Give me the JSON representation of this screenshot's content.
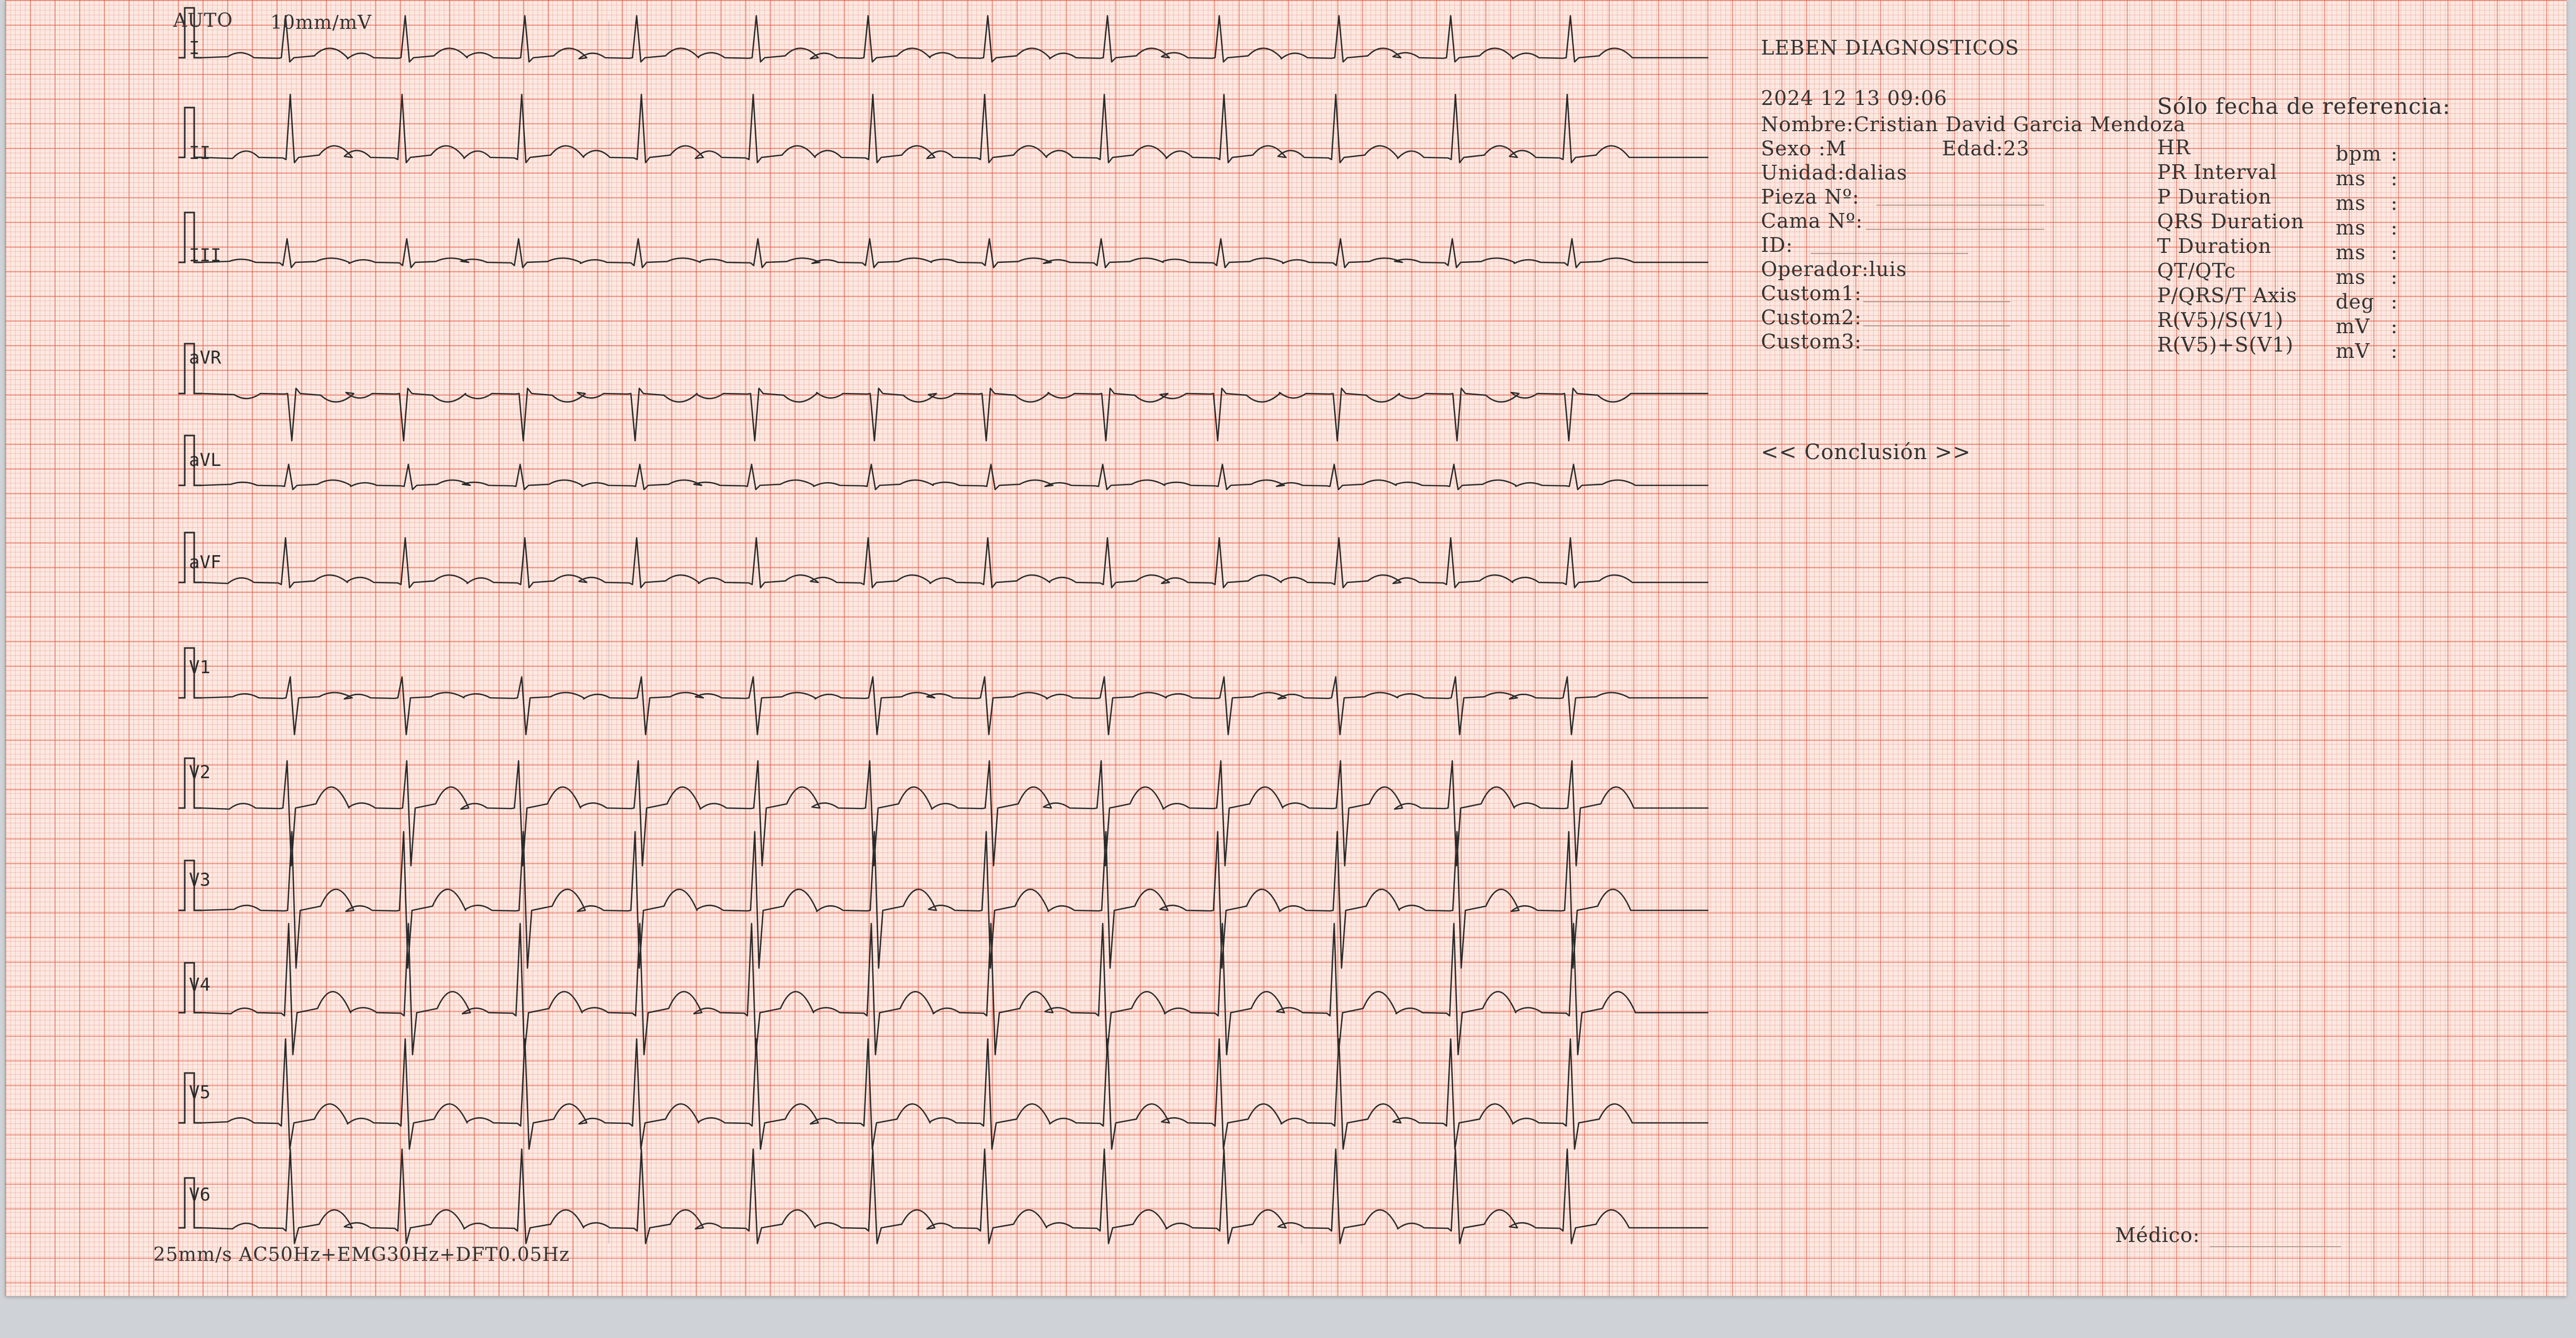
{
  "header": {
    "mode": "AUTO",
    "gain": "10mm/mV",
    "footer_settings": "25mm/s   AC50Hz+EMG30Hz+DFT0.05Hz"
  },
  "clinic": "LEBEN DIAGNOSTICOS",
  "patient": {
    "datetime": "2024 12 13 09:06",
    "name": "Nombre:Cristian David Garcia Mendoza",
    "sex": "Sexo  :M",
    "age": "Edad:23",
    "unit": "Unidad:dalias",
    "piece": "Pieza Nº:",
    "bed": "Cama Nº:",
    "id": "ID:",
    "operator": "Operador:luis",
    "custom1": "Custom1:",
    "custom2": "Custom2:",
    "custom3": "Custom3:"
  },
  "measurements": {
    "reference_note": "Sólo fecha de referencia:",
    "rows": [
      {
        "label": "HR",
        "unit": "bpm",
        "value": ":"
      },
      {
        "label": "PR Interval",
        "unit": "ms",
        "value": ":"
      },
      {
        "label": "P Duration",
        "unit": "ms",
        "value": ":"
      },
      {
        "label": "QRS Duration",
        "unit": "ms",
        "value": ":"
      },
      {
        "label": "T Duration",
        "unit": "ms",
        "value": ":"
      },
      {
        "label": "QT/QTc",
        "unit": "ms",
        "value": ":"
      },
      {
        "label": "P/QRS/T Axis",
        "unit": "deg",
        "value": ":"
      },
      {
        "label": "R(V5)/S(V1)",
        "unit": "mV",
        "value": ":"
      },
      {
        "label": "R(V5)+S(V1)",
        "unit": "mV",
        "value": ":"
      }
    ]
  },
  "conclusion": "<< Conclusión >>",
  "physician": "Médico:",
  "leads": [
    "I",
    "II",
    "III",
    "aVR",
    "aVL",
    "aVF",
    "V1",
    "V2",
    "V3",
    "V4",
    "V5",
    "V6"
  ],
  "colors": {
    "paper": "#fbe9e2",
    "grid_major": "#e25842",
    "grid_minor": "#ec826e",
    "trace": "#2a2a2a"
  }
}
